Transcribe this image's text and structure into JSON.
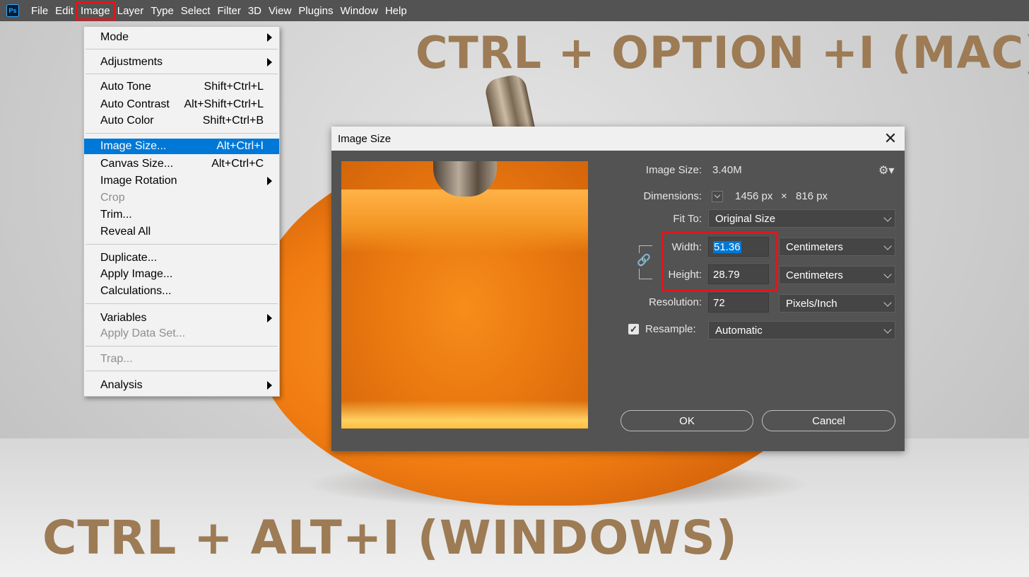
{
  "menubar": {
    "app_icon": "ps-logo-icon",
    "logo_text": "Ps",
    "items": [
      "File",
      "Edit",
      "Image",
      "Layer",
      "Type",
      "Select",
      "Filter",
      "3D",
      "View",
      "Plugins",
      "Window",
      "Help"
    ],
    "active": "Image"
  },
  "image_menu": {
    "items": [
      {
        "label": "Mode",
        "shortcut": "",
        "submenu": true,
        "disabled": false
      },
      {
        "label": "Adjustments",
        "shortcut": "",
        "submenu": true,
        "disabled": false
      },
      {
        "label": "Auto Tone",
        "shortcut": "Shift+Ctrl+L",
        "submenu": false,
        "disabled": false
      },
      {
        "label": "Auto Contrast",
        "shortcut": "Alt+Shift+Ctrl+L",
        "submenu": false,
        "disabled": false
      },
      {
        "label": "Auto Color",
        "shortcut": "Shift+Ctrl+B",
        "submenu": false,
        "disabled": false
      },
      {
        "label": "Image Size...",
        "shortcut": "Alt+Ctrl+I",
        "submenu": false,
        "disabled": false,
        "highlighted": true
      },
      {
        "label": "Canvas Size...",
        "shortcut": "Alt+Ctrl+C",
        "submenu": false,
        "disabled": false
      },
      {
        "label": "Image Rotation",
        "shortcut": "",
        "submenu": true,
        "disabled": false
      },
      {
        "label": "Crop",
        "shortcut": "",
        "submenu": false,
        "disabled": true
      },
      {
        "label": "Trim...",
        "shortcut": "",
        "submenu": false,
        "disabled": false
      },
      {
        "label": "Reveal All",
        "shortcut": "",
        "submenu": false,
        "disabled": false
      },
      {
        "label": "Duplicate...",
        "shortcut": "",
        "submenu": false,
        "disabled": false
      },
      {
        "label": "Apply Image...",
        "shortcut": "",
        "submenu": false,
        "disabled": false
      },
      {
        "label": "Calculations...",
        "shortcut": "",
        "submenu": false,
        "disabled": false
      },
      {
        "label": "Variables",
        "shortcut": "",
        "submenu": true,
        "disabled": false
      },
      {
        "label": "Apply Data Set...",
        "shortcut": "",
        "submenu": false,
        "disabled": true
      },
      {
        "label": "Trap...",
        "shortcut": "",
        "submenu": false,
        "disabled": true
      },
      {
        "label": "Analysis",
        "shortcut": "",
        "submenu": true,
        "disabled": false
      }
    ]
  },
  "dialog": {
    "title": "Image Size",
    "close_glyph": "✕",
    "image_size_label": "Image Size:",
    "image_size_value": "3.40M",
    "dimensions_label": "Dimensions:",
    "dimensions_width": "1456 px",
    "dimensions_sep": "×",
    "dimensions_height": "816 px",
    "fit_to_label": "Fit To:",
    "fit_to_value": "Original Size",
    "width_label": "Width:",
    "width_value": "51.36",
    "width_unit": "Centimeters",
    "height_label": "Height:",
    "height_value": "28.79",
    "height_unit": "Centimeters",
    "resolution_label": "Resolution:",
    "resolution_value": "72",
    "resolution_unit": "Pixels/Inch",
    "resample_label": "Resample:",
    "resample_checked": true,
    "resample_value": "Automatic",
    "ok_label": "OK",
    "cancel_label": "Cancel"
  },
  "captions": {
    "mac": "CTRL + OPTION +I (MAC)",
    "windows": "CTRL + ALT+I (WINDOWS)"
  },
  "colors": {
    "highlight_red": "#e3151a",
    "menu_selection": "#0078d7",
    "caption_brown": "#9c7b55"
  }
}
